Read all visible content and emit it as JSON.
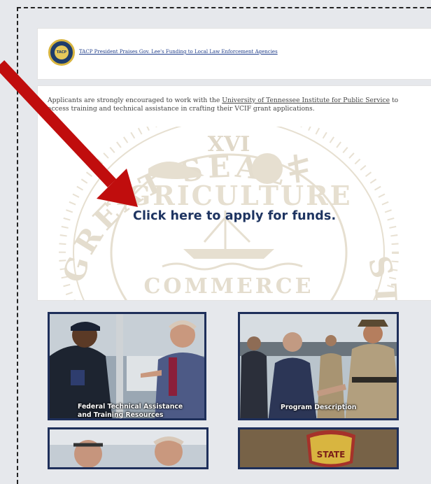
{
  "news": {
    "logo_text": "TACP",
    "link_label": "TACP President Praises Gov. Lee's Funding to Local Law Enforcement Agencies"
  },
  "apply": {
    "intro_before": "Applicants are strongly encouraged to work with the ",
    "intro_link": "University of Tennessee Institute for Public Service",
    "intro_after": " to access training and technical assistance in crafting their VCIF grant applications.",
    "cta": "Click here to apply for funds.",
    "seal_text": {
      "number": "XVI",
      "agriculture": "AGRICULTURE",
      "commerce": "COMMERCE",
      "ring_left": "GREAT SEAL",
      "ring_right": "STATE OF TENNESSEE"
    }
  },
  "tiles": [
    {
      "label_line1": "Federal Technical Assistance",
      "label_line2": "and Training Resources"
    },
    {
      "label_line1": "Program Description",
      "label_line2": ""
    },
    {
      "label_line1": "",
      "label_line2": ""
    },
    {
      "label_line1": "",
      "label_line2": "",
      "patch_text": "STATE"
    }
  ],
  "colors": {
    "arrow": "#c00d0d",
    "cta": "#1e3461",
    "tile_border": "#1e2f5a"
  }
}
